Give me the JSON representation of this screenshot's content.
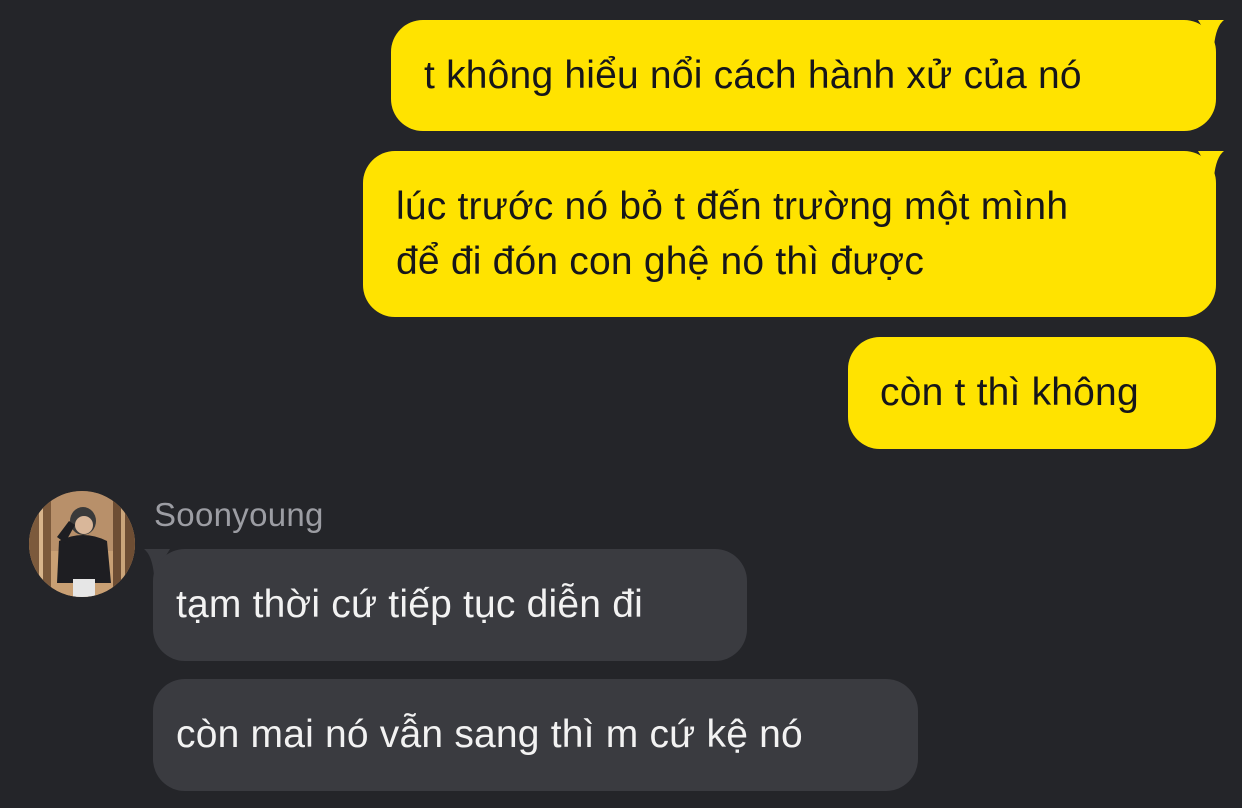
{
  "chat": {
    "outgoing": [
      {
        "lines": [
          "t không hiểu nổi cách hành xử của nó"
        ]
      },
      {
        "lines": [
          "lúc trước nó bỏ t đến trường một mình",
          "để đi đón con ghệ nó thì được"
        ]
      },
      {
        "lines": [
          "còn t thì không"
        ]
      }
    ],
    "contact": {
      "name": "Soonyoung",
      "avatar_icon": "profile-photo"
    },
    "incoming": [
      {
        "lines": [
          "tạm thời cứ tiếp tục diễn đi"
        ]
      },
      {
        "lines": [
          "còn mai nó vẫn sang thì m cứ kệ nó"
        ]
      }
    ]
  },
  "colors": {
    "background": "#242529",
    "outgoing_bubble": "#FFE300",
    "incoming_bubble": "#3a3b40",
    "name_text": "#9c9da3"
  }
}
